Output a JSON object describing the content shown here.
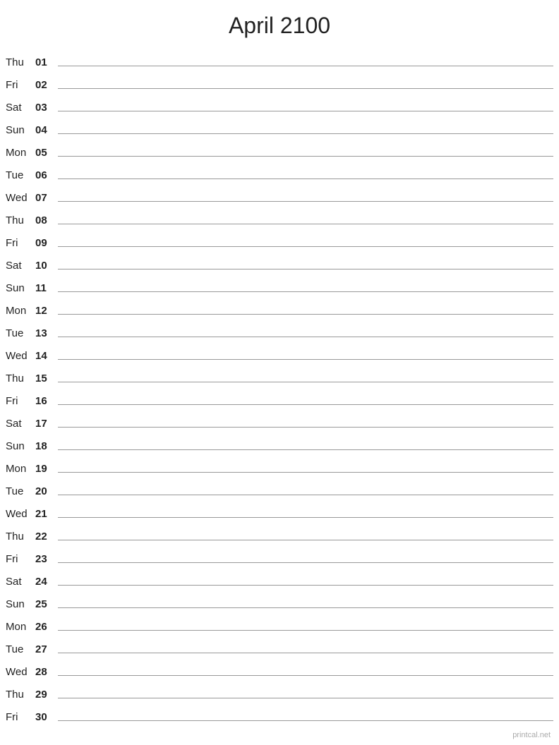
{
  "title": "April 2100",
  "watermark": "printcal.net",
  "days": [
    {
      "name": "Thu",
      "number": "01"
    },
    {
      "name": "Fri",
      "number": "02"
    },
    {
      "name": "Sat",
      "number": "03"
    },
    {
      "name": "Sun",
      "number": "04"
    },
    {
      "name": "Mon",
      "number": "05"
    },
    {
      "name": "Tue",
      "number": "06"
    },
    {
      "name": "Wed",
      "number": "07"
    },
    {
      "name": "Thu",
      "number": "08"
    },
    {
      "name": "Fri",
      "number": "09"
    },
    {
      "name": "Sat",
      "number": "10"
    },
    {
      "name": "Sun",
      "number": "11"
    },
    {
      "name": "Mon",
      "number": "12"
    },
    {
      "name": "Tue",
      "number": "13"
    },
    {
      "name": "Wed",
      "number": "14"
    },
    {
      "name": "Thu",
      "number": "15"
    },
    {
      "name": "Fri",
      "number": "16"
    },
    {
      "name": "Sat",
      "number": "17"
    },
    {
      "name": "Sun",
      "number": "18"
    },
    {
      "name": "Mon",
      "number": "19"
    },
    {
      "name": "Tue",
      "number": "20"
    },
    {
      "name": "Wed",
      "number": "21"
    },
    {
      "name": "Thu",
      "number": "22"
    },
    {
      "name": "Fri",
      "number": "23"
    },
    {
      "name": "Sat",
      "number": "24"
    },
    {
      "name": "Sun",
      "number": "25"
    },
    {
      "name": "Mon",
      "number": "26"
    },
    {
      "name": "Tue",
      "number": "27"
    },
    {
      "name": "Wed",
      "number": "28"
    },
    {
      "name": "Thu",
      "number": "29"
    },
    {
      "name": "Fri",
      "number": "30"
    }
  ]
}
